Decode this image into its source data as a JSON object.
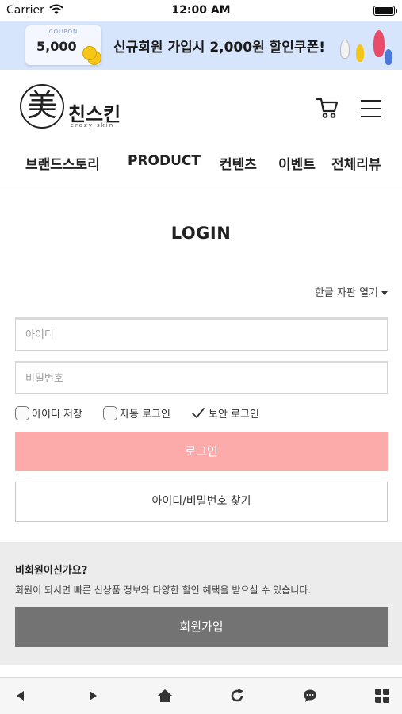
{
  "status_bar": {
    "carrier": "Carrier",
    "time": "12:00 AM"
  },
  "promo": {
    "coupon_label": "COUPON",
    "coupon_amount": "5,000",
    "text": "신규회원 가입시 2,000원 할인쿠폰!"
  },
  "header": {
    "logo_mark": "美",
    "logo_name": "친스킨",
    "logo_sub": "crazy skin",
    "cart_icon": "cart-icon",
    "menu_icon": "hamburger-menu-icon"
  },
  "nav": {
    "items": [
      {
        "label": "브랜드스토리"
      },
      {
        "label": "PRODUCT"
      },
      {
        "label": "컨텐츠"
      },
      {
        "label": "이벤트"
      },
      {
        "label": "전체리뷰"
      }
    ]
  },
  "login": {
    "title": "LOGIN",
    "keyboard_toggle": "한글 자판 열기",
    "id_placeholder": "아이디",
    "password_placeholder": "비밀번호",
    "save_id_label": "아이디 저장",
    "auto_login_label": "자동 로그인",
    "secure_login_label": "보안 로그인",
    "login_button": "로그인",
    "find_button": "아이디/비밀번호 찾기"
  },
  "join": {
    "title": "비회원이신가요?",
    "description": "회원이 되시면 빠른 신상품 정보와 다양한 할인 혜택을 받으실 수 있습니다.",
    "button": "회원가입"
  },
  "bottom_bar": {
    "icons": [
      "back-icon",
      "forward-icon",
      "home-icon",
      "reload-icon",
      "chat-icon",
      "apps-grid-icon"
    ]
  },
  "colors": {
    "promo_bg": "#d6e5fb",
    "login_button_bg": "#fdaaaa",
    "join_button_bg": "#737373",
    "join_section_bg": "#ececec"
  }
}
